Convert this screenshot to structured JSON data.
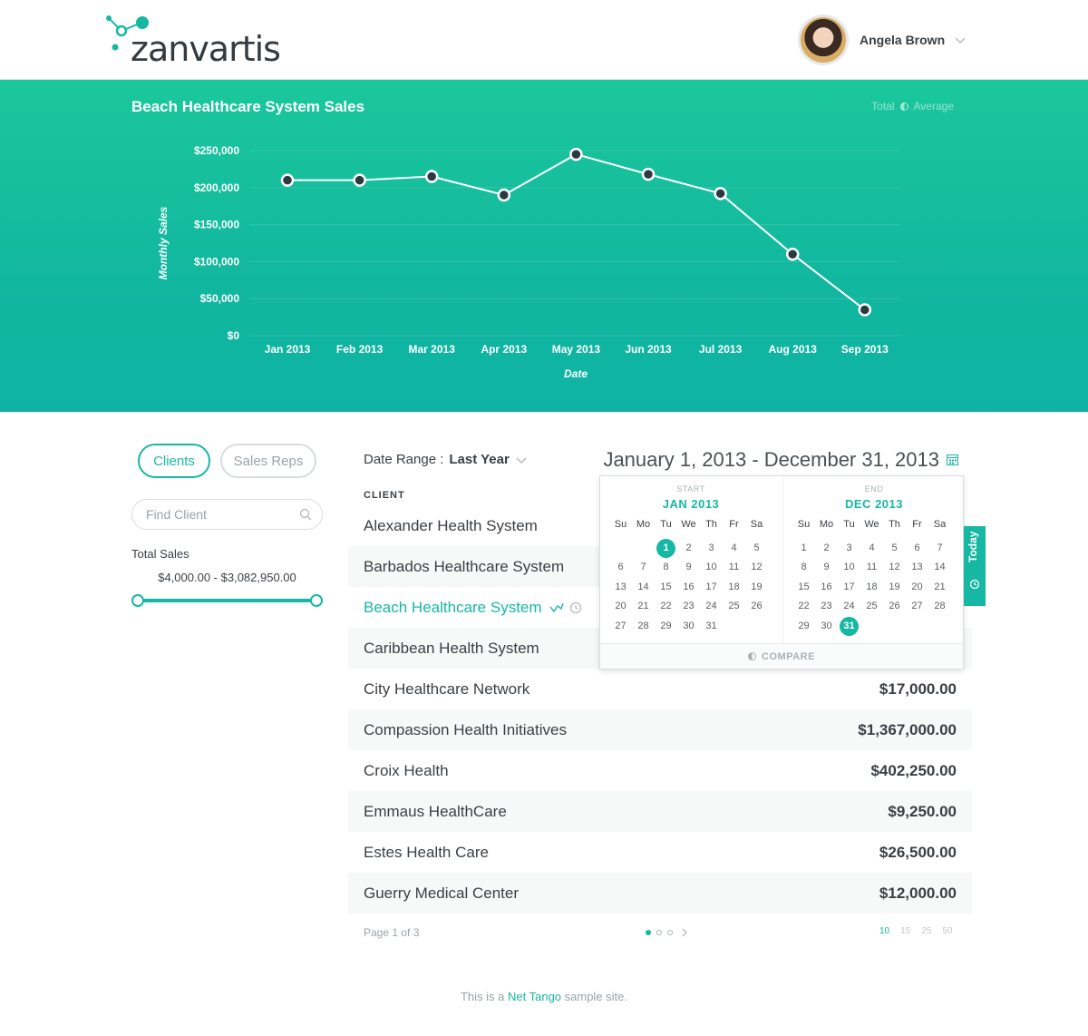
{
  "header": {
    "logo_text": "zanvartis",
    "user_name": "Angela Brown"
  },
  "chart": {
    "title": "Beach Healthcare System Sales",
    "legend_total": "Total",
    "legend_average": "Average"
  },
  "chart_data": {
    "type": "line",
    "x": [
      "Jan 2013",
      "Feb 2013",
      "Mar 2013",
      "Apr 2013",
      "May 2013",
      "Jun 2013",
      "Jul 2013",
      "Aug 2013",
      "Sep 2013"
    ],
    "y": [
      210000,
      210000,
      215000,
      190000,
      245000,
      218000,
      192000,
      110000,
      35000
    ],
    "xlabel": "Date",
    "ylabel": "Monthly Sales",
    "ylim": [
      0,
      250000
    ],
    "yticks": [
      "$0",
      "$50,000",
      "$100,000",
      "$150,000",
      "$200,000",
      "$250,000"
    ],
    "grid": true
  },
  "filters": {
    "clients_label": "Clients",
    "sales_reps_label": "Sales Reps",
    "find_placeholder": "Find Client",
    "total_sales_label": "Total Sales",
    "total_sales_range": "$4,000.00  -  $3,082,950.00",
    "slider_min_fraction": 0,
    "slider_max_fraction": 1
  },
  "main": {
    "date_range_label": "Date Range :",
    "date_range_value": "Last Year",
    "date_display": "January 1, 2013 - December 31, 2013",
    "column_header": "CLIENT",
    "rows": [
      {
        "name": "Alexander Health System",
        "amount": ""
      },
      {
        "name": "Barbados Healthcare System",
        "amount": ""
      },
      {
        "name": "Beach Healthcare System",
        "amount": ""
      },
      {
        "name": "Caribbean Health System",
        "amount": ""
      },
      {
        "name": "City Healthcare Network",
        "amount": "$17,000.00"
      },
      {
        "name": "Compassion Health Initiatives",
        "amount": "$1,367,000.00"
      },
      {
        "name": "Croix Health",
        "amount": "$402,250.00"
      },
      {
        "name": "Emmaus HealthCare",
        "amount": "$9,250.00"
      },
      {
        "name": "Estes Health Care",
        "amount": "$26,500.00"
      },
      {
        "name": "Guerry Medical Center",
        "amount": "$12,000.00"
      }
    ],
    "page_text": "Page 1 of 3",
    "page_sizes": [
      "10",
      "15",
      "25",
      "50"
    ]
  },
  "calendar": {
    "start_caption": "START",
    "start_month": "JAN",
    "start_year": "2013",
    "end_caption": "END",
    "end_month": "DEC",
    "end_year": "2013",
    "day_headers": [
      "Su",
      "Mo",
      "Tu",
      "We",
      "Th",
      "Fr",
      "Sa"
    ],
    "start_weeks": [
      [
        "",
        "",
        "1",
        "2",
        "3",
        "4",
        "5"
      ],
      [
        "6",
        "7",
        "8",
        "9",
        "10",
        "11",
        "12"
      ],
      [
        "13",
        "14",
        "15",
        "16",
        "17",
        "18",
        "19"
      ],
      [
        "20",
        "21",
        "22",
        "23",
        "24",
        "25",
        "26"
      ],
      [
        "27",
        "28",
        "29",
        "30",
        "31",
        "",
        ""
      ]
    ],
    "end_weeks": [
      [
        "1",
        "2",
        "3",
        "4",
        "5",
        "6",
        "7"
      ],
      [
        "8",
        "9",
        "10",
        "11",
        "12",
        "13",
        "14"
      ],
      [
        "15",
        "16",
        "17",
        "18",
        "19",
        "20",
        "21"
      ],
      [
        "22",
        "23",
        "24",
        "25",
        "26",
        "27",
        "28"
      ],
      [
        "29",
        "30",
        "31",
        "",
        "",
        "",
        ""
      ]
    ],
    "start_selected": "1",
    "end_selected": "31",
    "compare_label": "COMPARE",
    "today_label": "Today"
  },
  "footer": {
    "prefix": "This is a ",
    "link": "Net Tango",
    "suffix": " sample site."
  },
  "colors": {
    "accent": "#16b8a3",
    "hero_top": "#1bc79b",
    "hero_bottom": "#0fb3a3",
    "point": "#2b3a42"
  }
}
